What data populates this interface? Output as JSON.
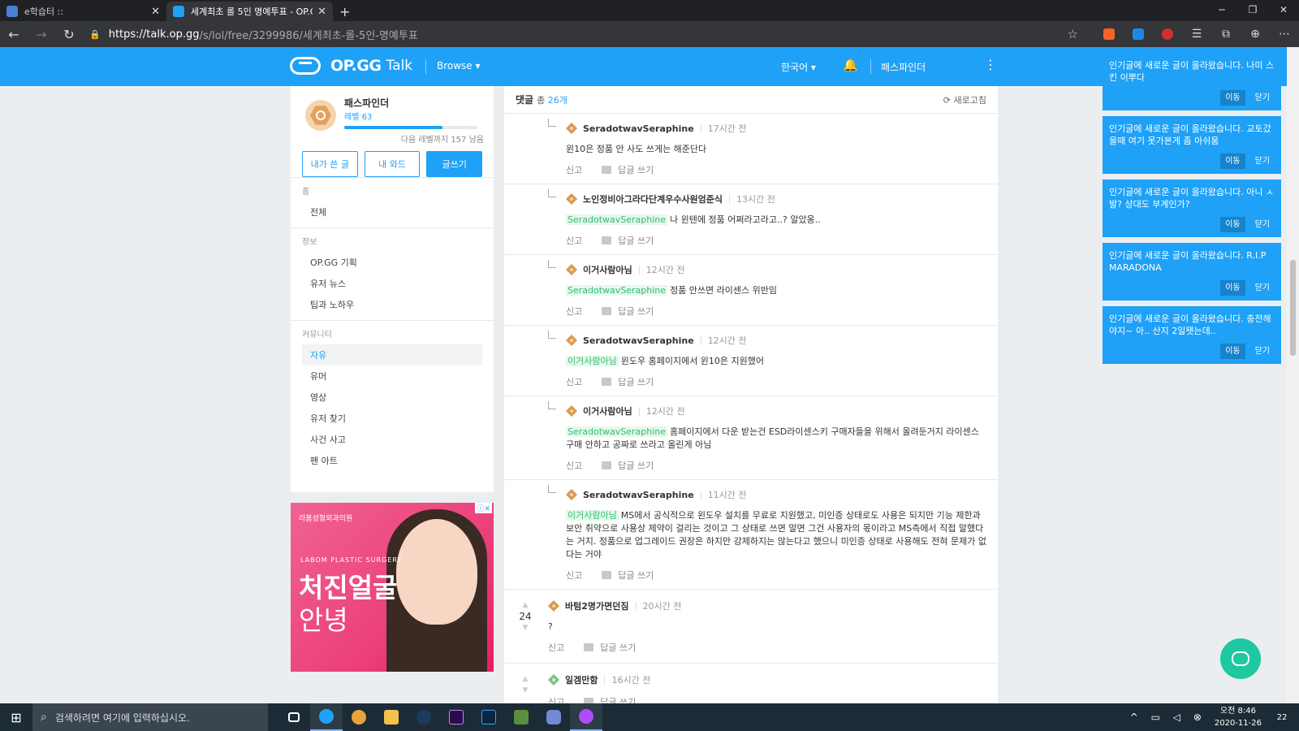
{
  "browser": {
    "tabs": [
      {
        "title": "e학습터 ::",
        "active": false
      },
      {
        "title": "세계최초 롤 5인 명예투표 - OP.G",
        "active": true
      }
    ],
    "url_host": "https://talk.op.gg",
    "url_path": "/s/lol/free/3299986/세계최초-롤-5인-명예투표"
  },
  "header": {
    "brand": "OP.GG",
    "talk": "Talk",
    "browse": "Browse ▾",
    "language": "한국어 ▾",
    "username": "패스파인더"
  },
  "profile": {
    "name": "패스파인더",
    "level": "레벨 63",
    "level_progress": 0.74,
    "next_level": "다음 레벨까지 157 남음",
    "buttons": {
      "my_posts": "내가 쓴 글",
      "my_comments": "내 와드",
      "write": "글쓰기"
    }
  },
  "nav": {
    "home": {
      "header": "홈",
      "items": [
        "전체"
      ]
    },
    "info": {
      "header": "정보",
      "items": [
        "OP.GG 기획",
        "유저 뉴스",
        "팁과 노하우"
      ]
    },
    "community": {
      "header": "커뮤니티",
      "items": [
        "자유",
        "유머",
        "영상",
        "유저 찾기",
        "사건 사고",
        "팬 아트"
      ],
      "active": "자유"
    }
  },
  "ad": {
    "small": "라봄성형외과의원",
    "sub": "LABOM PLASTIC SURGERY",
    "line1": "처진얼굴",
    "line2": "안녕"
  },
  "comments_header": {
    "label": "댓글",
    "count_prefix": "총",
    "count": "26개",
    "refresh": "새로고침"
  },
  "replies": [
    {
      "author": "SeradotwavSeraphine",
      "time": "17시간 전",
      "mention": "",
      "text": "윈10은 정품 안 사도 쓰게는 해준단다"
    },
    {
      "author": "노인정비아그라다단계우수사원엄준식",
      "time": "13시간 전",
      "mention": "SeradotwavSeraphine",
      "text": "나 윈텐에 정품 어쩌라고라고..? 알았옹.."
    },
    {
      "author": "이거사람아님",
      "time": "12시간 전",
      "mention": "SeradotwavSeraphine",
      "text": "정품 안쓰면 라이센스 위반임"
    },
    {
      "author": "SeradotwavSeraphine",
      "time": "12시간 전",
      "mention": "이거사람아님",
      "text": "윈도우 홈페이지에서 윈10은 지원했어"
    },
    {
      "author": "이거사람아님",
      "time": "12시간 전",
      "mention": "SeradotwavSeraphine",
      "text": "홈페이지에서 다운 받는건 ESD라이센스키 구매자들을 위해서 올려둔거지 라이센스 구매 안하고 공짜로 쓰라고 올린게 아님"
    },
    {
      "author": "SeradotwavSeraphine",
      "time": "11시간 전",
      "mention": "이거사람아님",
      "text": "MS에서 공식적으로 윈도우 설치를 무료로 지원했고, 미인증 상태로도 사용은 되지만 기능 제한과 보안 취약으로 사용상 제약이 걸리는 것이고 그 상태로 쓰면 말면 그건 사용자의 몫이라고 MS측에서 직접 말했다는 거지. 정품으로 업그레이드 권장은 하지만 강제하지는 않는다고 했으니 미인증 상태로 사용해도 전혀 문제가 없다는 거야"
    }
  ],
  "actions": {
    "report": "신고",
    "reply": "답글 쓰기"
  },
  "top_comments": [
    {
      "author": "바텀2명가면던짐",
      "time": "20시간 전",
      "votes": "24",
      "text": "?"
    },
    {
      "author": "일겜만함",
      "time": "16시간 전",
      "votes": "",
      "text": ""
    }
  ],
  "notifications": {
    "items": [
      "인기글에 새로운 글이 올라왔습니다. 나미 스킨 이뿌다",
      "인기글에 새로운 글이 올라왔습니다. 교토갔을때 여기 못가본게 좀 아쉬움",
      "인기글에 새로운 글이 올라왔습니다. 아니 ㅅ발? 상대도 부계인가?",
      "인기글에 새로운 글이 올라왔습니다. R.I.P MARADONA",
      "인기글에 새로운 글이 올라왔습니다. 충전해야지~ 아.. 산지 2일됏는데.."
    ],
    "go": "이동",
    "close": "닫기"
  },
  "taskbar": {
    "search_placeholder": "검색하려면 여기에 입력하십시오.",
    "time": "오전 8:46",
    "date": "2020-11-26",
    "notif_count": "22"
  },
  "colors": {
    "accent": "#1ea1f7",
    "mention_green": "#2fbf71",
    "chat_fab": "#1ec8a0"
  }
}
